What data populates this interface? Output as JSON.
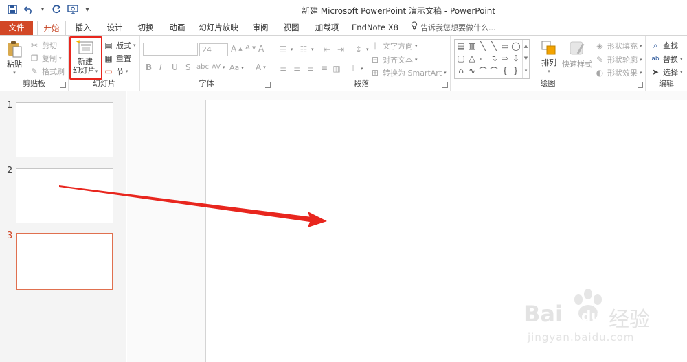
{
  "window": {
    "title": "新建 Microsoft PowerPoint 演示文稿 - PowerPoint"
  },
  "qat": {
    "save_icon": "save-icon",
    "undo_icon": "undo-icon",
    "redo_icon": "redo-icon",
    "present_icon": "present-from-start-icon"
  },
  "tabs": [
    {
      "label": "文件"
    },
    {
      "label": "开始"
    },
    {
      "label": "插入"
    },
    {
      "label": "设计"
    },
    {
      "label": "切换"
    },
    {
      "label": "动画"
    },
    {
      "label": "幻灯片放映"
    },
    {
      "label": "审阅"
    },
    {
      "label": "视图"
    },
    {
      "label": "加载项"
    },
    {
      "label": "EndNote X8"
    }
  ],
  "tellme": {
    "placeholder": "告诉我您想要做什么..."
  },
  "ribbon": {
    "clipboard": {
      "label": "剪贴板",
      "paste": "粘贴",
      "cut": "剪切",
      "copy": "复制",
      "format_painter": "格式刷"
    },
    "slides": {
      "label": "幻灯片",
      "new_line1": "新建",
      "new_line2": "幻灯片",
      "layout": "版式",
      "reset": "重置",
      "section": "节"
    },
    "font": {
      "label": "字体",
      "size": "24",
      "bold": "B",
      "italic": "I",
      "underline": "U",
      "shadow": "S",
      "strike": "abc",
      "spacing": "AV",
      "case": "Aa",
      "color": "A",
      "grow": "A",
      "shrink": "A",
      "clear": "A"
    },
    "paragraph": {
      "label": "段落",
      "text_direction": "文字方向",
      "align_text": "对齐文本",
      "smartart": "转换为 SmartArt"
    },
    "drawing": {
      "label": "绘图",
      "arrange": "排列",
      "quick_styles": "快速样式",
      "fill": "形状填充",
      "outline": "形状轮廓",
      "effects": "形状效果"
    },
    "editing": {
      "label": "编辑",
      "find": "查找",
      "replace": "替换",
      "select": "选择"
    }
  },
  "slides_pane": [
    {
      "num": "1"
    },
    {
      "num": "2"
    },
    {
      "num": "3"
    }
  ],
  "watermark": {
    "brand": "Bai",
    "brand2": "du",
    "cn": "经验",
    "url": "jingyan.baidu.com"
  },
  "colors": {
    "accent": "#d24726",
    "highlight_red": "#e8261e",
    "thumb_selected": "#e0704f"
  }
}
